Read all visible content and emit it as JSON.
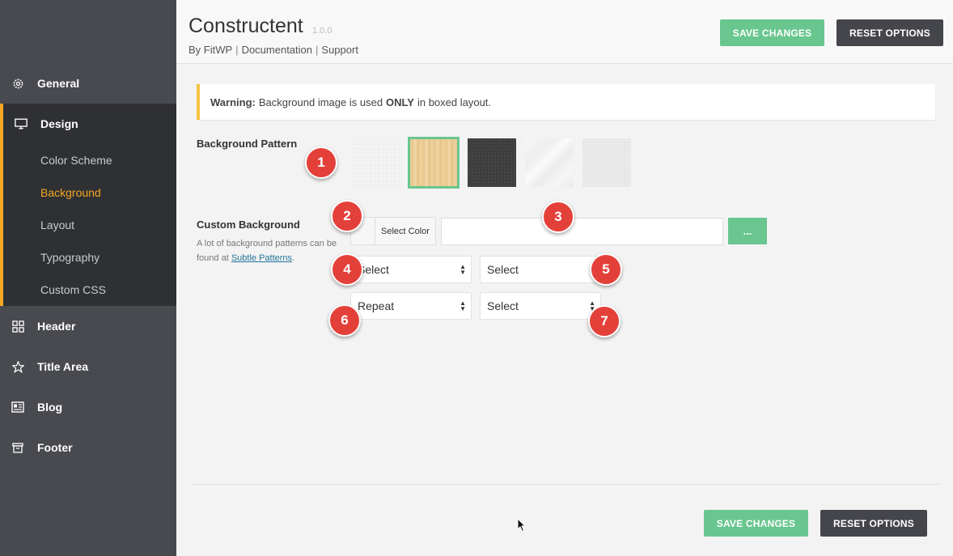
{
  "app": {
    "title": "Constructent",
    "version": "1.0.0",
    "links": [
      "By FitWP",
      "Documentation",
      "Support"
    ]
  },
  "buttons": {
    "save": "SAVE CHANGES",
    "reset": "RESET OPTIONS"
  },
  "sidebar": {
    "items": [
      {
        "label": "General",
        "icon": "gear-icon"
      },
      {
        "label": "Design",
        "icon": "monitor-icon"
      },
      {
        "label": "Header",
        "icon": "grid-icon"
      },
      {
        "label": "Title Area",
        "icon": "star-icon"
      },
      {
        "label": "Blog",
        "icon": "news-icon"
      },
      {
        "label": "Footer",
        "icon": "footer-icon"
      }
    ],
    "submenu": [
      "Color Scheme",
      "Background",
      "Layout",
      "Typography",
      "Custom CSS"
    ],
    "current_submenu": "Background"
  },
  "warning": {
    "prefix": "Warning:",
    "text1": "Background image is used",
    "strong": "ONLY",
    "text2": "in boxed layout."
  },
  "background_pattern": {
    "label": "Background Pattern",
    "patterns": [
      "light-grey",
      "wood",
      "dark",
      "white-shards",
      "light-texture"
    ],
    "selected_index": 1
  },
  "custom_background": {
    "label": "Custom Background",
    "desc_before": "A lot of background patterns can be found at",
    "desc_link": "Subtle Patterns",
    "desc_after": ".",
    "select_color": "Select Color",
    "url_value": "",
    "upload_label": "...",
    "selects": [
      {
        "value": "Select"
      },
      {
        "value": "Select"
      },
      {
        "value": "Repeat"
      },
      {
        "value": "Select"
      }
    ]
  },
  "annotations": [
    "1",
    "2",
    "3",
    "4",
    "5",
    "6",
    "7"
  ],
  "colors": {
    "accent": "#69c68f",
    "sidebar": "#484a4f",
    "sidebar_active": "#2f3034",
    "highlight": "#f5a623",
    "badge": "#e4403a"
  }
}
